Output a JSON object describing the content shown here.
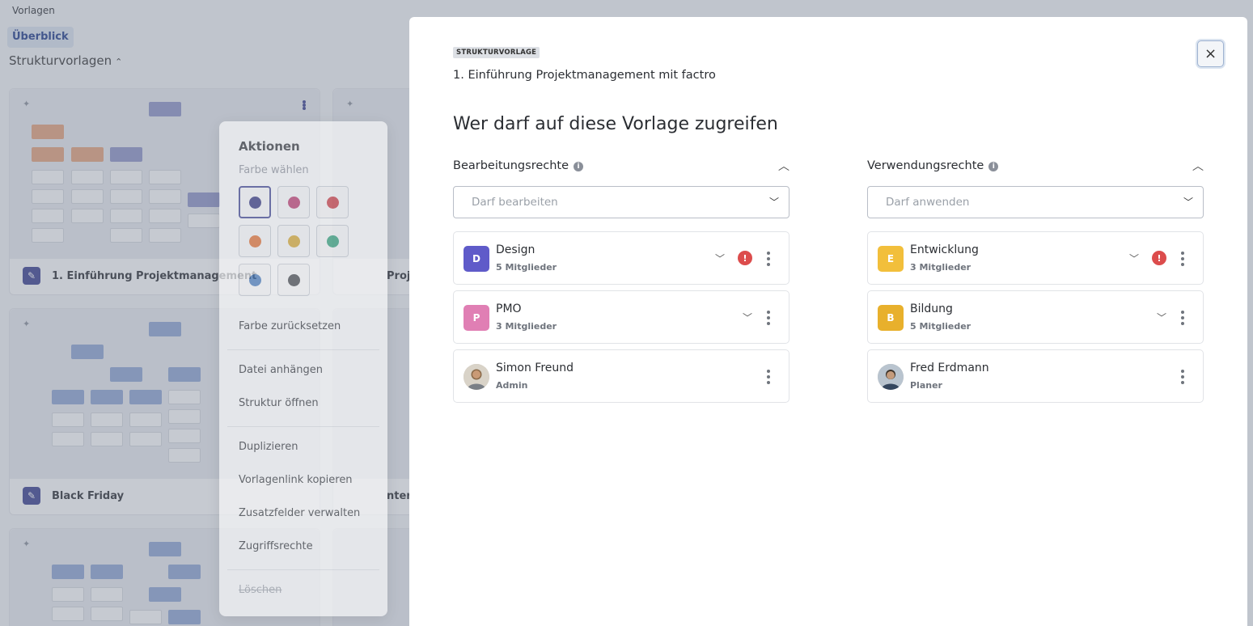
{
  "breadcrumb": "Vorlagen",
  "tab_active": "Überblick",
  "section": {
    "title": "Strukturvorlagen",
    "chevron": "⌃"
  },
  "cards": [
    {
      "title": "1. Einführung Projektmanagement"
    },
    {
      "title": "Proje"
    },
    {
      "title": "Black Friday"
    },
    {
      "title": "nter"
    }
  ],
  "menu": {
    "title": "Aktionen",
    "color_label": "Farbe wählen",
    "swatches": [
      "#2b2e7a",
      "#b8336a",
      "#c8323a",
      "#e06a2a",
      "#d4a52a",
      "#2a9c74",
      "#3f74b8",
      "#3a3d42"
    ],
    "reset_color": "Farbe zurücksetzen",
    "attach_file": "Datei anhängen",
    "open_structure": "Struktur öffnen",
    "duplicate": "Duplizieren",
    "copy_link": "Vorlagenlink kopieren",
    "manage_fields": "Zusatzfelder verwalten",
    "access_rights": "Zugriffsrechte",
    "delete": "Löschen"
  },
  "modal": {
    "badge": "STRUKTURVORLAGE",
    "template_name": "1. Einführung Projektmanagement mit factro",
    "heading": "Wer darf auf diese Vorlage zugreifen",
    "close_icon": "×",
    "edit": {
      "title": "Bearbeitungsrechte",
      "placeholder": "Darf bearbeiten",
      "entries": [
        {
          "initial": "D",
          "name": "Design",
          "sub": "5 Mitglieder",
          "color": "#5f5bc9",
          "warning": "!"
        },
        {
          "initial": "P",
          "name": "PMO",
          "sub": "3 Mitglieder",
          "color": "#e07fb4"
        },
        {
          "name": "Simon Freund",
          "sub": "Admin"
        }
      ]
    },
    "use": {
      "title": "Verwendungsrechte",
      "placeholder": "Darf anwenden",
      "entries": [
        {
          "initial": "E",
          "name": "Entwicklung",
          "sub": "3 Mitglieder",
          "color": "#f2bf3b",
          "warning": "!"
        },
        {
          "initial": "B",
          "name": "Bildung",
          "sub": "5 Mitglieder",
          "color": "#e8b02c"
        },
        {
          "name": "Fred Erdmann",
          "sub": "Planer"
        }
      ]
    },
    "info_icon": "i"
  }
}
